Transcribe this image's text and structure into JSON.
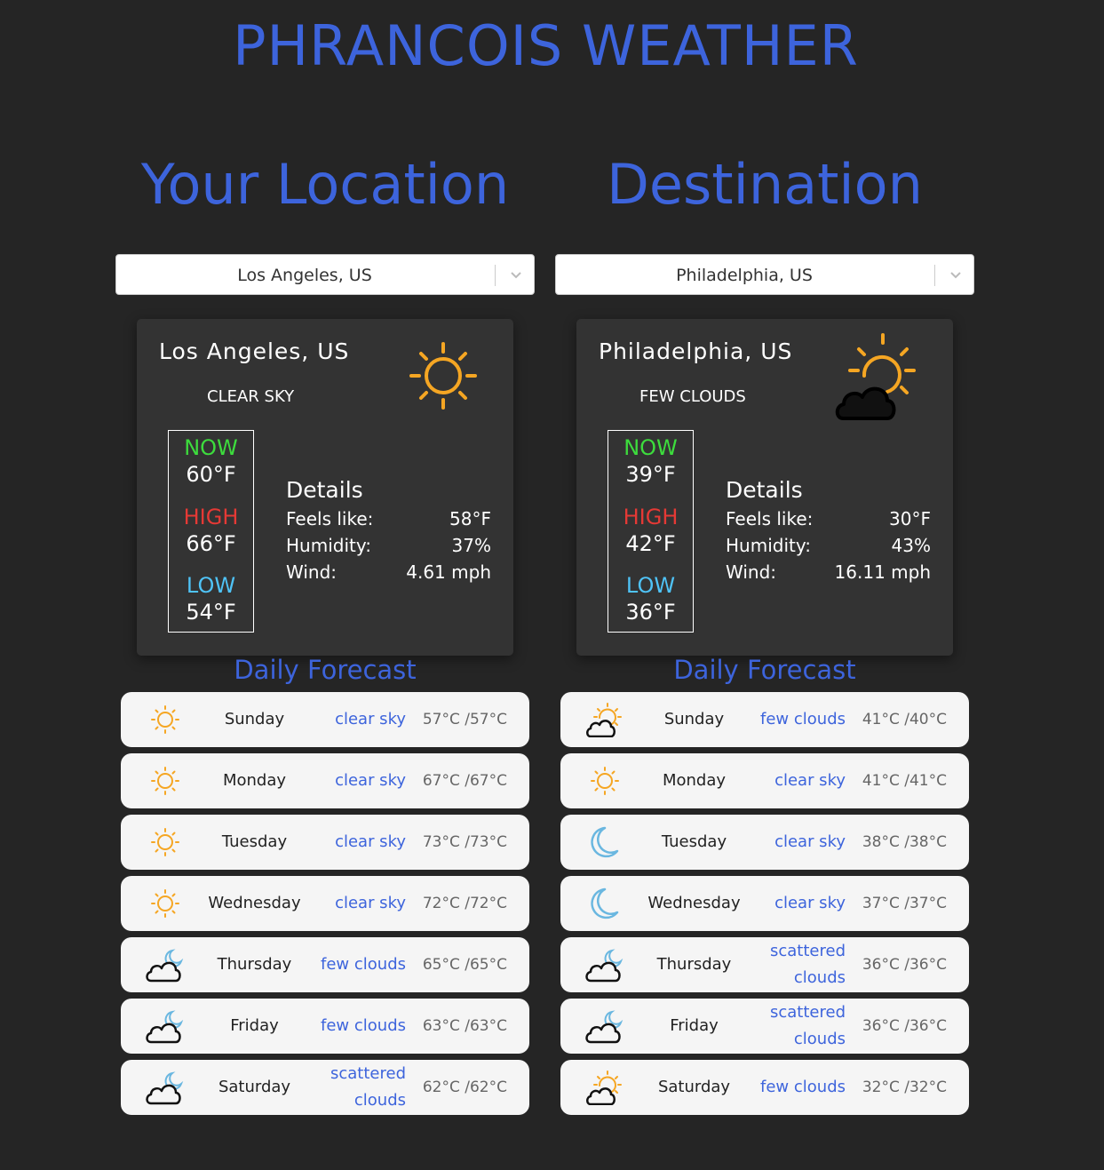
{
  "app": {
    "title": "PHRANCOIS WEATHER"
  },
  "colors": {
    "accent": "#3d64dc",
    "now": "#3ddc3d",
    "high": "#e53935",
    "low": "#4fc3f7",
    "sun": "#f5a623",
    "moon": "#6ab7e0",
    "background": "#252525",
    "card": "#333333"
  },
  "left": {
    "heading": "Your Location",
    "select_value": "Los Angeles, US",
    "card": {
      "city": "Los Angeles, US",
      "description": "CLEAR SKY",
      "icon": "sun-icon",
      "now_label": "NOW",
      "now_temp": "60°F",
      "high_label": "HIGH",
      "high_temp": "66°F",
      "low_label": "LOW",
      "low_temp": "54°F",
      "details_title": "Details",
      "feels_label": "Feels like:",
      "feels_value": "58°F",
      "humidity_label": "Humidity:",
      "humidity_value": "37%",
      "wind_label": "Wind:",
      "wind_value": "4.61 mph"
    },
    "forecast_title": "Daily Forecast",
    "forecast": [
      {
        "day": "Sunday",
        "desc": "clear sky",
        "temp": "57°C /57°C",
        "icon": "sun-icon"
      },
      {
        "day": "Monday",
        "desc": "clear sky",
        "temp": "67°C /67°C",
        "icon": "sun-icon"
      },
      {
        "day": "Tuesday",
        "desc": "clear sky",
        "temp": "73°C /73°C",
        "icon": "sun-icon"
      },
      {
        "day": "Wednesday",
        "desc": "clear sky",
        "temp": "72°C /72°C",
        "icon": "sun-icon"
      },
      {
        "day": "Thursday",
        "desc": "few clouds",
        "temp": "65°C /65°C",
        "icon": "cloud-moon-icon"
      },
      {
        "day": "Friday",
        "desc": "few clouds",
        "temp": "63°C /63°C",
        "icon": "cloud-moon-icon"
      },
      {
        "day": "Saturday",
        "desc": "scattered clouds",
        "temp": "62°C /62°C",
        "icon": "cloud-moon-icon"
      }
    ]
  },
  "right": {
    "heading": "Destination",
    "select_value": "Philadelphia, US",
    "card": {
      "city": "Philadelphia, US",
      "description": "FEW CLOUDS",
      "icon": "cloud-sun-icon",
      "now_label": "NOW",
      "now_temp": "39°F",
      "high_label": "HIGH",
      "high_temp": "42°F",
      "low_label": "LOW",
      "low_temp": "36°F",
      "details_title": "Details",
      "feels_label": "Feels like:",
      "feels_value": "30°F",
      "humidity_label": "Humidity:",
      "humidity_value": "43%",
      "wind_label": "Wind:",
      "wind_value": "16.11 mph"
    },
    "forecast_title": "Daily Forecast",
    "forecast": [
      {
        "day": "Sunday",
        "desc": "few clouds",
        "temp": "41°C /40°C",
        "icon": "cloud-sun-icon"
      },
      {
        "day": "Monday",
        "desc": "clear sky",
        "temp": "41°C /41°C",
        "icon": "sun-icon"
      },
      {
        "day": "Tuesday",
        "desc": "clear sky",
        "temp": "38°C /38°C",
        "icon": "moon-icon"
      },
      {
        "day": "Wednesday",
        "desc": "clear sky",
        "temp": "37°C /37°C",
        "icon": "moon-icon"
      },
      {
        "day": "Thursday",
        "desc": "scattered clouds",
        "temp": "36°C /36°C",
        "icon": "cloud-moon-icon"
      },
      {
        "day": "Friday",
        "desc": "scattered clouds",
        "temp": "36°C /36°C",
        "icon": "cloud-moon-icon"
      },
      {
        "day": "Saturday",
        "desc": "few clouds",
        "temp": "32°C /32°C",
        "icon": "cloud-sun-icon"
      }
    ]
  }
}
